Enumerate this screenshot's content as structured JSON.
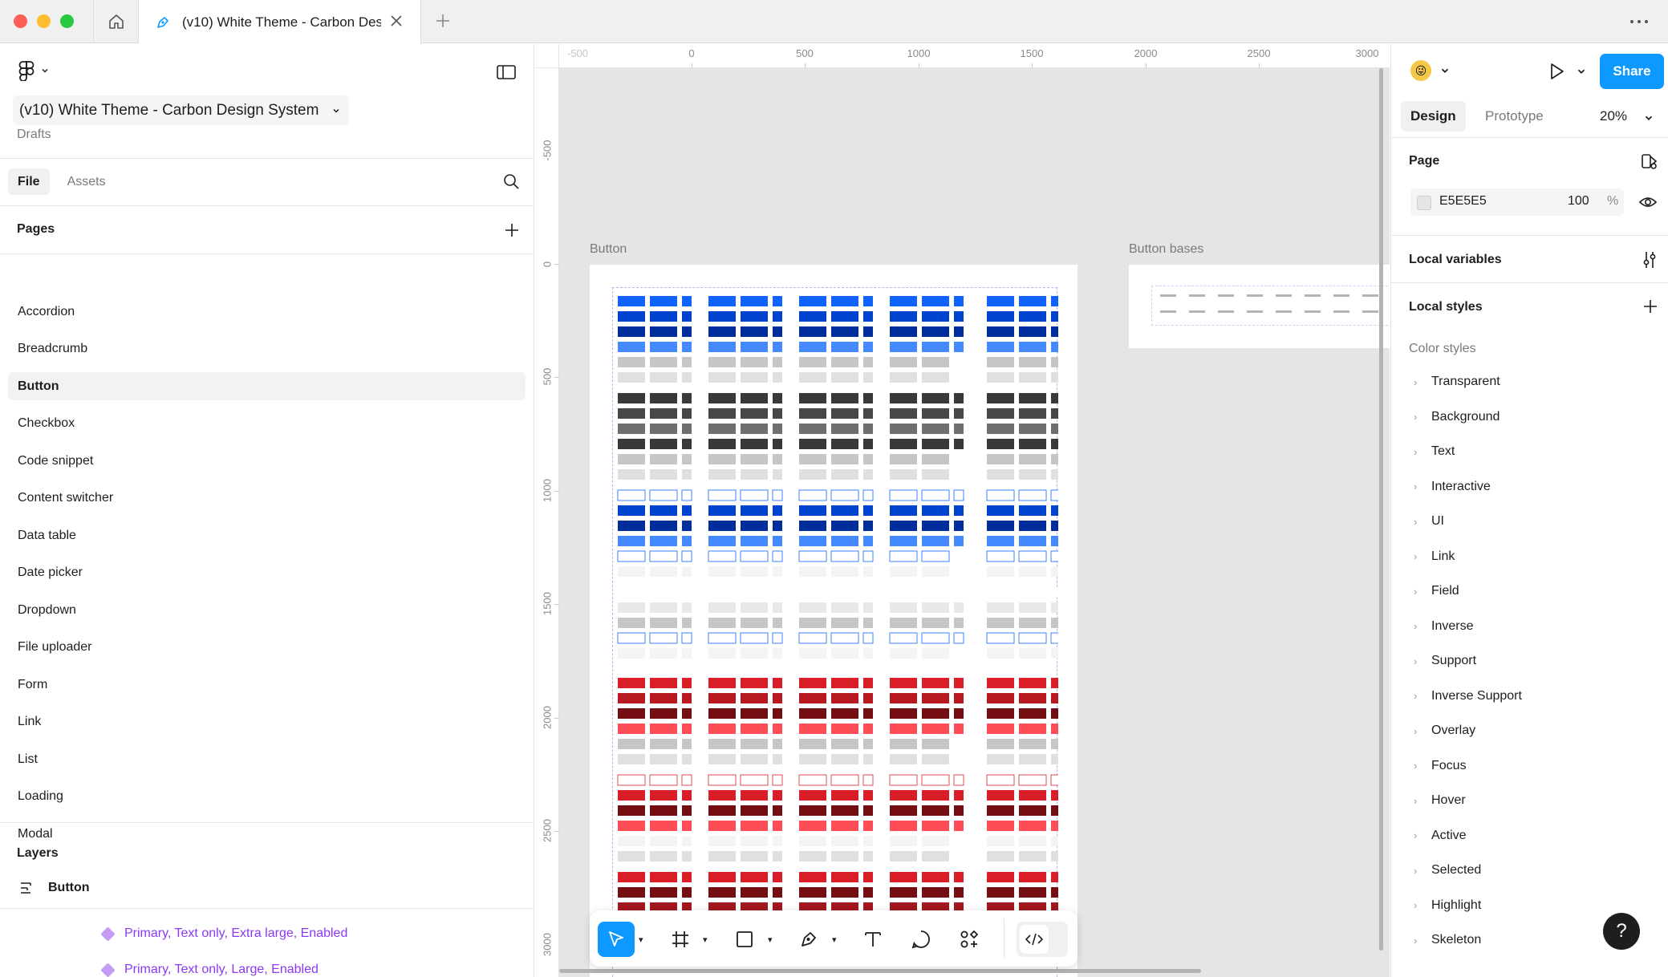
{
  "window": {
    "tab_title": "(v10) White Theme - Carbon Des"
  },
  "left": {
    "file_name": "(v10) White Theme - Carbon Design System",
    "location": "Drafts",
    "tabs": {
      "file": "File",
      "assets": "Assets"
    },
    "pages_header": "Pages",
    "pages": [
      {
        "label": "Accordion"
      },
      {
        "label": "Breadcrumb"
      },
      {
        "label": "Button",
        "active": true
      },
      {
        "label": "Checkbox"
      },
      {
        "label": "Code snippet"
      },
      {
        "label": "Content switcher"
      },
      {
        "label": "Data table"
      },
      {
        "label": "Date picker"
      },
      {
        "label": "Dropdown"
      },
      {
        "label": "File uploader"
      },
      {
        "label": "Form"
      },
      {
        "label": "Link"
      },
      {
        "label": "List"
      },
      {
        "label": "Loading"
      },
      {
        "label": "Modal"
      }
    ],
    "layers_header": "Layers",
    "layer_root": "Button",
    "layer_children": [
      "Primary, Text only, Extra large, Enabled",
      "Primary, Text only, Large, Enabled"
    ]
  },
  "canvas": {
    "ruler_x": [
      "-500",
      "0",
      "500",
      "1000",
      "1500",
      "2000",
      "2500",
      "3000"
    ],
    "ruler_y": [
      "-500",
      "0",
      "500",
      "1000",
      "1500",
      "2000",
      "2500",
      "3000"
    ],
    "frames": {
      "button": "Button",
      "bases": "Button bases"
    },
    "background": "#E5E5E5",
    "accent_blue": "#0F62FE",
    "danger_red": "#DA1E28"
  },
  "right": {
    "share": "Share",
    "tabs": {
      "design": "Design",
      "prototype": "Prototype"
    },
    "zoom": "20%",
    "page_header": "Page",
    "page_color": "E5E5E5",
    "page_opacity": "100",
    "page_opacity_unit": "%",
    "local_variables": "Local variables",
    "local_styles": "Local styles",
    "color_styles_label": "Color styles",
    "color_styles": [
      "Transparent",
      "Background",
      "Text",
      "Interactive",
      "UI",
      "Link",
      "Field",
      "Inverse",
      "Support",
      "Inverse Support",
      "Overlay",
      "Focus",
      "Hover",
      "Active",
      "Selected",
      "Highlight",
      "Skeleton"
    ],
    "help": "?"
  }
}
